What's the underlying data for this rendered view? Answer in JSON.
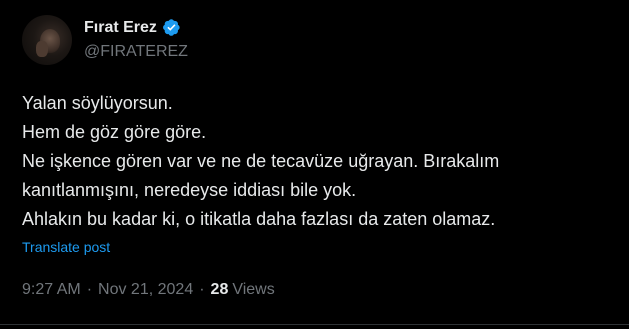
{
  "author": {
    "display_name": "Fırat Erez",
    "handle": "@FIRATEREZ",
    "verified_icon": "verified-badge-icon"
  },
  "post": {
    "lines": [
      "Yalan söylüyorsun.",
      "Hem de göz göre göre.",
      "Ne işkence gören var ve ne de tecavüze uğrayan. Bırakalım",
      "kanıtlanmışını, neredeyse iddiası bile yok.",
      "Ahlakın bu kadar ki, o itikatla daha fazlası da zaten olamaz."
    ],
    "translate_label": "Translate post"
  },
  "meta": {
    "time": "9:27 AM",
    "separator": "·",
    "date": "Nov 21, 2024",
    "views_count": "28",
    "views_label": "Views"
  },
  "colors": {
    "background": "#000000",
    "text": "#e7e9ea",
    "secondary": "#71767b",
    "accent": "#1d9bf0"
  }
}
